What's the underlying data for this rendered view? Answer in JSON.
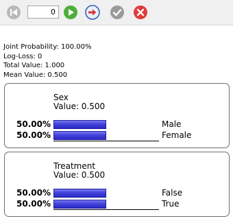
{
  "toolbar": {
    "step_value": "0",
    "buttons": [
      {
        "name": "first-step-icon"
      },
      {
        "name": "play-icon"
      },
      {
        "name": "step-forward-icon"
      },
      {
        "name": "check-icon"
      },
      {
        "name": "cancel-icon"
      }
    ]
  },
  "stats": {
    "joint_probability": "Joint Probability: 100.00%",
    "log_loss": "Log-Loss: 0",
    "total_value": "Total Value: 1.000",
    "mean_value": "Mean Value: 0.500"
  },
  "nodes": [
    {
      "title": "Sex",
      "value_text": "Value: 0.500",
      "states": [
        {
          "label": "Male",
          "percent": "50.00%",
          "fraction": 0.5
        },
        {
          "label": "Female",
          "percent": "50.00%",
          "fraction": 0.5
        }
      ]
    },
    {
      "title": "Treatment",
      "value_text": "Value: 0.500",
      "states": [
        {
          "label": "False",
          "percent": "50.00%",
          "fraction": 0.5
        },
        {
          "label": "True",
          "percent": "50.00%",
          "fraction": 0.5
        }
      ]
    }
  ],
  "colors": {
    "bar": "#3c3cd8",
    "play": "#4caf3a",
    "cancel": "#e03b3b",
    "check": "#9a9a9a"
  }
}
